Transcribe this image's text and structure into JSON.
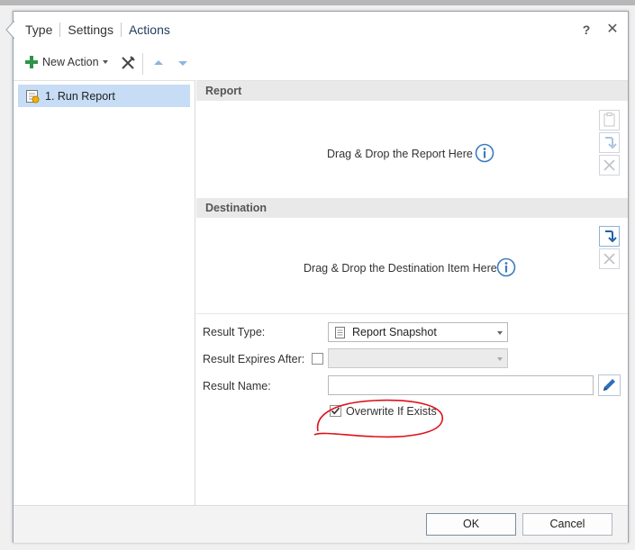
{
  "header": {
    "tabs": [
      {
        "label": "Type"
      },
      {
        "label": "Settings"
      },
      {
        "label": "Actions"
      }
    ],
    "help_label": "?",
    "close_label": "✕"
  },
  "toolbar": {
    "new_action_label": "New Action"
  },
  "actions_list": {
    "items": [
      {
        "label": "1. Run Report"
      }
    ]
  },
  "report_section": {
    "title": "Report",
    "drop_text": "Drag & Drop the Report Here"
  },
  "destination_section": {
    "title": "Destination",
    "drop_text": "Drag & Drop the Destination Item Here"
  },
  "form": {
    "result_type_label": "Result Type:",
    "result_type_value": "Report Snapshot",
    "result_expires_label": "Result Expires After:",
    "result_expires_value": "",
    "result_name_label": "Result Name:",
    "result_name_value": "",
    "overwrite_label": "Overwrite If Exists",
    "overwrite_checked": true
  },
  "footer": {
    "ok_label": "OK",
    "cancel_label": "Cancel"
  },
  "colors": {
    "accent": "#3a7bbf",
    "selection": "#c7dcf5",
    "annotation": "#e0101a"
  }
}
